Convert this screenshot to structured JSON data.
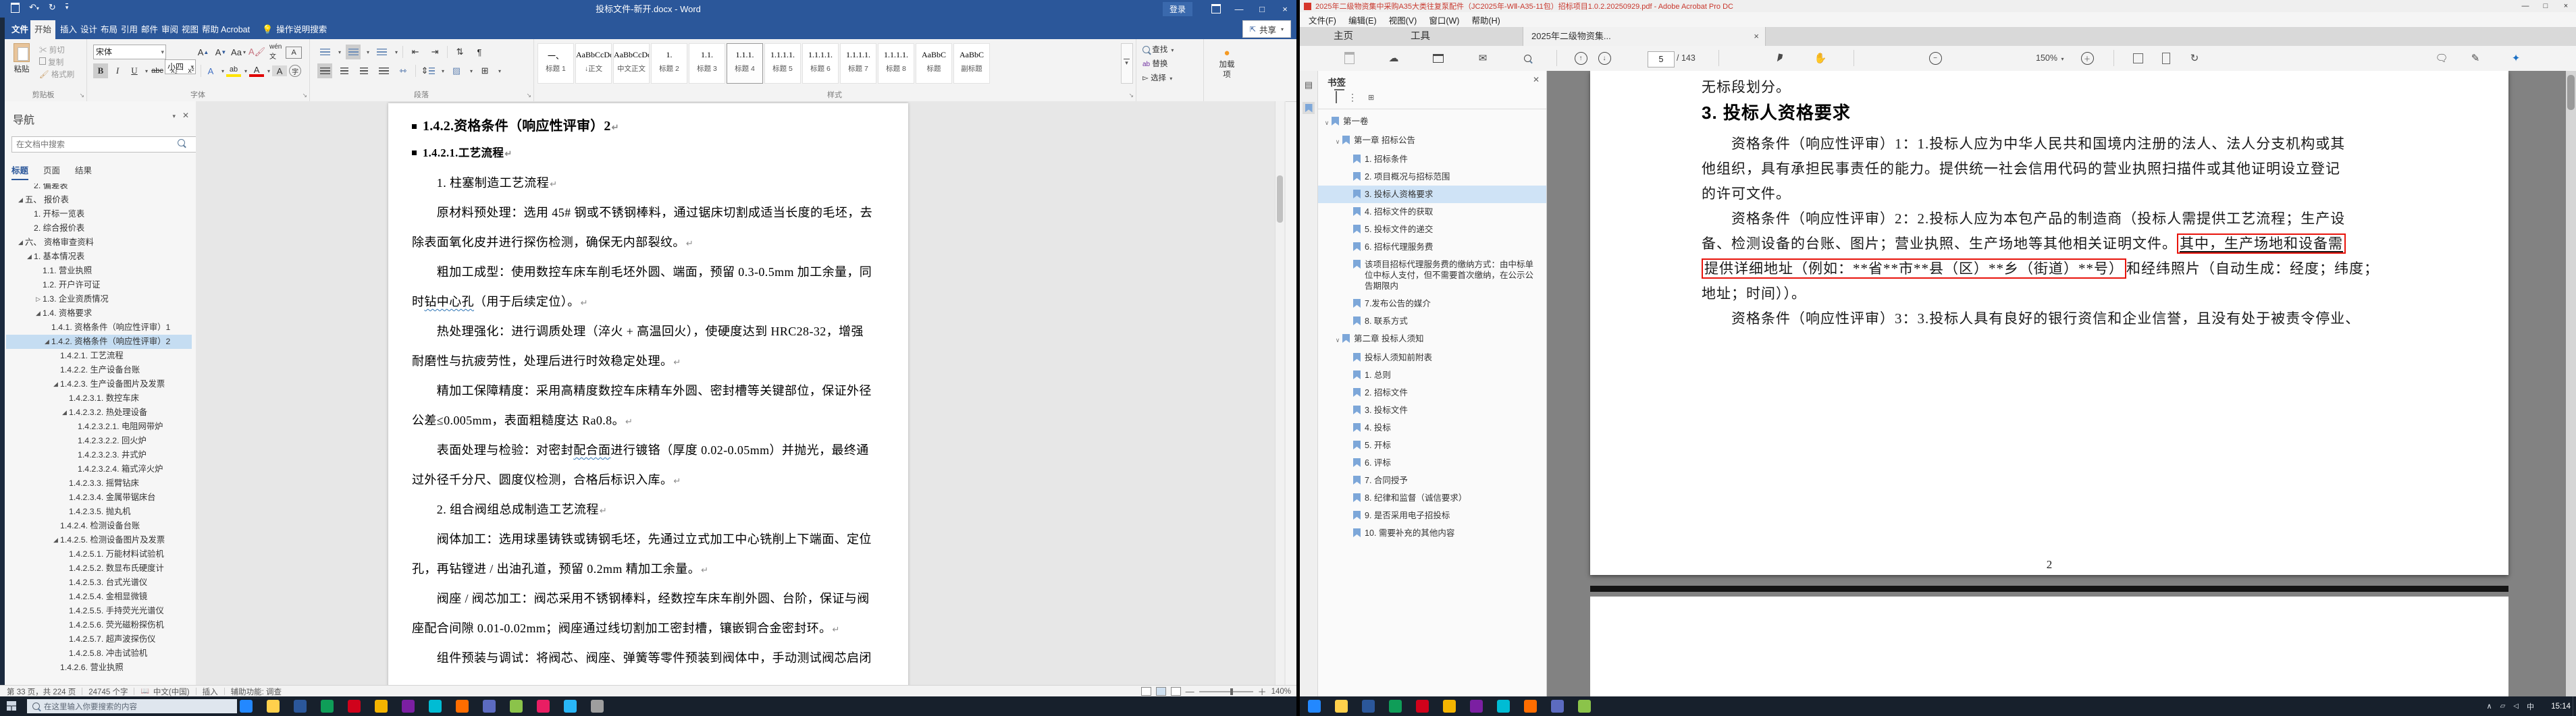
{
  "word": {
    "title": "投标文件-新开.docx  -  Word",
    "signin": "登录",
    "share": "共享",
    "file_tab": "文件",
    "tabs": [
      "开始",
      "插入",
      "设计",
      "布局",
      "引用",
      "邮件",
      "审阅",
      "视图",
      "帮助",
      "Acrobat"
    ],
    "active_tab": "开始",
    "tell_me": "操作说明搜索",
    "ribbon": {
      "clipboard": {
        "label": "剪贴板",
        "paste": "粘贴",
        "cut": "剪切",
        "copy": "复制",
        "painter": "格式刷"
      },
      "font": {
        "label": "字体",
        "name": "宋体",
        "size": "小四"
      },
      "paragraph": {
        "label": "段落"
      },
      "styles_label": "样式",
      "styles": [
        {
          "preview": "一、",
          "name": "标题 1",
          "sel": false
        },
        {
          "preview": "AaBbCcDd",
          "name": "↓正文",
          "sel": false
        },
        {
          "preview": "AaBbCcDc",
          "name": "中文正文",
          "sel": false
        },
        {
          "preview": "1.",
          "name": "标题 2",
          "sel": false
        },
        {
          "preview": "1.1.",
          "name": "标题 3",
          "sel": false
        },
        {
          "preview": "1.1.1.",
          "name": "标题 4",
          "sel": true
        },
        {
          "preview": "1.1.1.1.",
          "name": "标题 5",
          "sel": false
        },
        {
          "preview": "1.1.1.1.",
          "name": "标题 6",
          "sel": false
        },
        {
          "preview": "1.1.1.1.",
          "name": "标题 7",
          "sel": false
        },
        {
          "preview": "1.1.1.1.",
          "name": "标题 8",
          "sel": false
        },
        {
          "preview": "AaBbC",
          "name": "标题",
          "sel": false
        },
        {
          "preview": "AaBbC",
          "name": "副标题",
          "sel": false
        }
      ],
      "editing": {
        "find": "查找",
        "replace": "替换",
        "select": "选择"
      },
      "addins": {
        "label": "加载项"
      }
    },
    "nav": {
      "title": "导航",
      "search_placeholder": "在文档中搜索",
      "tabs": [
        "标题",
        "页面",
        "结果"
      ],
      "active_tab": "标题",
      "items": [
        {
          "lv": 2,
          "t": "2. 偏差表"
        },
        {
          "lv": 1,
          "c": "e",
          "t": "五、 报价表"
        },
        {
          "lv": 2,
          "t": "1. 开标一览表"
        },
        {
          "lv": 2,
          "t": "2. 综合报价表"
        },
        {
          "lv": 1,
          "c": "e",
          "t": "六、 资格审查资料"
        },
        {
          "lv": 2,
          "c": "e",
          "t": "1. 基本情况表"
        },
        {
          "lv": 3,
          "t": "1.1. 营业执照"
        },
        {
          "lv": 3,
          "t": "1.2. 开户许可证"
        },
        {
          "lv": 3,
          "c": "c",
          "t": "1.3. 企业资质情况"
        },
        {
          "lv": 3,
          "c": "e",
          "t": "1.4. 资格要求"
        },
        {
          "lv": 4,
          "t": "1.4.1. 资格条件（响应性评审）1"
        },
        {
          "lv": 4,
          "c": "e",
          "t": "1.4.2. 资格条件（响应性评审）2",
          "sel": true
        },
        {
          "lv": 5,
          "t": "1.4.2.1. 工艺流程"
        },
        {
          "lv": 5,
          "t": "1.4.2.2. 生产设备台账"
        },
        {
          "lv": 5,
          "c": "e",
          "t": "1.4.2.3. 生产设备图片及发票"
        },
        {
          "lv": 6,
          "t": "1.4.2.3.1. 数控车床"
        },
        {
          "lv": 6,
          "c": "e",
          "t": "1.4.2.3.2. 热处理设备"
        },
        {
          "lv": 7,
          "t": "1.4.2.3.2.1. 电阻网带炉"
        },
        {
          "lv": 7,
          "t": "1.4.2.3.2.2. 回火炉"
        },
        {
          "lv": 7,
          "t": "1.4.2.3.2.3. 井式炉"
        },
        {
          "lv": 7,
          "t": "1.4.2.3.2.4. 箱式淬火炉"
        },
        {
          "lv": 6,
          "t": "1.4.2.3.3. 摇臂钻床"
        },
        {
          "lv": 6,
          "t": "1.4.2.3.4. 金属带锯床台"
        },
        {
          "lv": 6,
          "t": "1.4.2.3.5. 抛丸机"
        },
        {
          "lv": 5,
          "t": "1.4.2.4. 检测设备台账"
        },
        {
          "lv": 5,
          "c": "e",
          "t": "1.4.2.5. 检测设备图片及发票"
        },
        {
          "lv": 6,
          "t": "1.4.2.5.1. 万能材料试验机"
        },
        {
          "lv": 6,
          "t": "1.4.2.5.2. 数显布氏硬度计"
        },
        {
          "lv": 6,
          "t": "1.4.2.5.3. 台式光谱仪"
        },
        {
          "lv": 6,
          "t": "1.4.2.5.4. 金相显微镜"
        },
        {
          "lv": 6,
          "t": "1.4.2.5.5. 手持荧光光谱仪"
        },
        {
          "lv": 6,
          "t": "1.4.2.5.6. 荧光磁粉探伤机"
        },
        {
          "lv": 6,
          "t": "1.4.2.5.7. 超声波探伤仪"
        },
        {
          "lv": 6,
          "t": "1.4.2.5.8. 冲击试验机"
        },
        {
          "lv": 5,
          "t": "1.4.2.6. 营业执照"
        }
      ]
    },
    "doc": {
      "lines": [
        {
          "type": "h1",
          "t": "1.4.2.资格条件（响应性评审）2",
          "end": true
        },
        {
          "type": "h2",
          "t": "1.4.2.1.工艺流程",
          "end": true
        },
        {
          "t": "　　1.  柱塞制造工艺流程",
          "end": true
        },
        {
          "t": "　　原材料预处理：选用 45# 钢或不锈钢棒料，通过锯床切割成适当长度的毛坯，去"
        },
        {
          "t": "除表面氧化皮并进行探伤检测，确保无内部裂纹。",
          "end": true
        },
        {
          "t": "　　粗加工成型：使用数控车床车削毛坯外圆、端面，预留 0.3-0.5mm 加工余量，同"
        },
        {
          "parts": [
            {
              "t": "时"
            },
            {
              "t": "钻中心孔",
              "wavy": true
            },
            {
              "t": "（用于后续定位）。"
            }
          ],
          "end": true
        },
        {
          "t": "　　热处理强化：进行调质处理（淬火 + 高温回火），使硬度达到 HRC28-32，增强"
        },
        {
          "t": "耐磨性与抗疲劳性，处理后进行时效稳定处理。",
          "end": true
        },
        {
          "t": "　　精加工保障精度：采用高精度数控车床精车外圆、密封槽等关键部位，保证外径"
        },
        {
          "t": "公差≤0.005mm，表面粗糙度达 Ra0.8。",
          "end": true
        },
        {
          "parts": [
            {
              "t": "　　表面处理与检验：对密封"
            },
            {
              "t": "配合面",
              "wavy": true
            },
            {
              "t": "进行镀铬（厚度 0.02-0.05mm）并抛光，最终通"
            }
          ]
        },
        {
          "t": "过外径千分尺、圆度仪检测，合格后标识入库。",
          "end": true
        },
        {
          "t": "　　2.  组合阀组总成制造工艺流程",
          "end": true
        },
        {
          "t": "　　阀体加工：选用球墨铸铁或铸钢毛坯，先通过立式加工中心铣削上下端面、定位"
        },
        {
          "t": "孔，再钻镗进 / 出油孔道，预留 0.2mm 精加工余量。",
          "end": true
        },
        {
          "t": "　　阀座 / 阀芯加工：阀芯采用不锈钢棒料，经数控车床车削外圆、台阶，保证与阀"
        },
        {
          "t": "座配合间隙 0.01-0.02mm；阀座通过线切割加工密封槽，镶嵌铜合金密封环。",
          "end": true
        },
        {
          "t": "　　组件预装与调试：将阀芯、阀座、弹簧等零件预装到阀体中，手动测试阀芯启闭"
        }
      ]
    },
    "status": {
      "page_info": "第 33 页，共 224 页",
      "words": "24745 个字",
      "lang": "中文(中国)",
      "mode": "插入",
      "accessibility": "辅助功能: 调查",
      "zoom": "140%"
    }
  },
  "taskbar_left": {
    "search_placeholder": "在这里输入你要搜索的内容",
    "app_count": 14
  },
  "acrobat": {
    "title": "2025年二级物资集中采购A35大类往复泵配件（JC2025年-WⅡ-A35-11包）招标项目1.0.2.20250929.pdf - Adobe Acrobat Pro DC",
    "menus": [
      "文件(F)",
      "编辑(E)",
      "视图(V)",
      "窗口(W)",
      "帮助(H)"
    ],
    "tabs": {
      "home": "主页",
      "tools": "工具",
      "doc": "2025年二级物资集..."
    },
    "toolbar": {
      "page": "5",
      "page_total": "/ 143",
      "zoom": "150%"
    },
    "panel": {
      "title": "书签",
      "items": [
        {
          "lv": 0,
          "c": 1,
          "t": "第一卷"
        },
        {
          "lv": 1,
          "c": 1,
          "t": "第一章 招标公告"
        },
        {
          "lv": 2,
          "t": "1. 招标条件"
        },
        {
          "lv": 2,
          "t": "2. 项目概况与招标范围"
        },
        {
          "lv": 2,
          "t": "3. 投标人资格要求",
          "sel": true
        },
        {
          "lv": 2,
          "t": "4. 招标文件的获取"
        },
        {
          "lv": 2,
          "t": "5. 投标文件的递交"
        },
        {
          "lv": 2,
          "t": "6. 招标代理服务费"
        },
        {
          "lv": 2,
          "t": "该项目招标代理服务费的缴纳方式：由中标单位中标人支付，但不需要首次缴纳，在公示公告期限内",
          "wrap": true
        },
        {
          "lv": 2,
          "t": "7.发布公告的媒介"
        },
        {
          "lv": 2,
          "t": "8. 联系方式"
        },
        {
          "lv": 1,
          "c": 1,
          "t": "第二章 投标人须知"
        },
        {
          "lv": 2,
          "t": "投标人须知前附表"
        },
        {
          "lv": 2,
          "t": "1. 总则"
        },
        {
          "lv": 2,
          "t": "2. 招标文件"
        },
        {
          "lv": 2,
          "t": "3. 投标文件"
        },
        {
          "lv": 2,
          "t": "4. 投标"
        },
        {
          "lv": 2,
          "t": "5. 开标"
        },
        {
          "lv": 2,
          "t": "6. 评标"
        },
        {
          "lv": 2,
          "t": "7. 合同授予"
        },
        {
          "lv": 2,
          "t": "8. 纪律和监督（诚信要求）",
          "wrap": true
        },
        {
          "lv": 2,
          "t": "9. 是否采用电子招投标"
        },
        {
          "lv": 2,
          "t": "10. 需要补充的其他内容"
        }
      ]
    },
    "page": {
      "tail": "无标段划分。",
      "heading": "3.  投标人资格要求",
      "lines": [
        {
          "t": "　　资格条件（响应性评审）1：1.投标人应为中华人民共和国境内注册的法人、法人分支机构或其"
        },
        {
          "t": "他组织，具有承担民事责任的能力。提供统一社会信用代码的营业执照扫描件或其他证明设立登记"
        },
        {
          "t": "的许可文件。"
        },
        {
          "t": "　　资格条件（响应性评审）2：2.投标人应为本包产品的制造商（投标人需提供工艺流程；生产设"
        },
        {
          "parts": [
            {
              "t": "备、检测设备的台账、图片；营业执照、生产场地等其他相关证明文件。"
            },
            {
              "t": "其中，生产场地和设备需",
              "box": true,
              "u": true
            }
          ]
        },
        {
          "parts": [
            {
              "t": "提供详细地址（例如：**省**市**县（区）**乡（街道）**号）",
              "box": true
            },
            {
              "t": "和经纬照片（自动生成：经度；纬度；"
            }
          ]
        },
        {
          "t": "地址；时间））。"
        },
        {
          "t": "　　资格条件（响应性评审）3：3.投标人具有良好的银行资信和企业信誉，且没有处于被责令停业、"
        }
      ],
      "page_number": "2"
    }
  },
  "taskbar_right": {
    "time": "15:14",
    "app_count": 11
  }
}
